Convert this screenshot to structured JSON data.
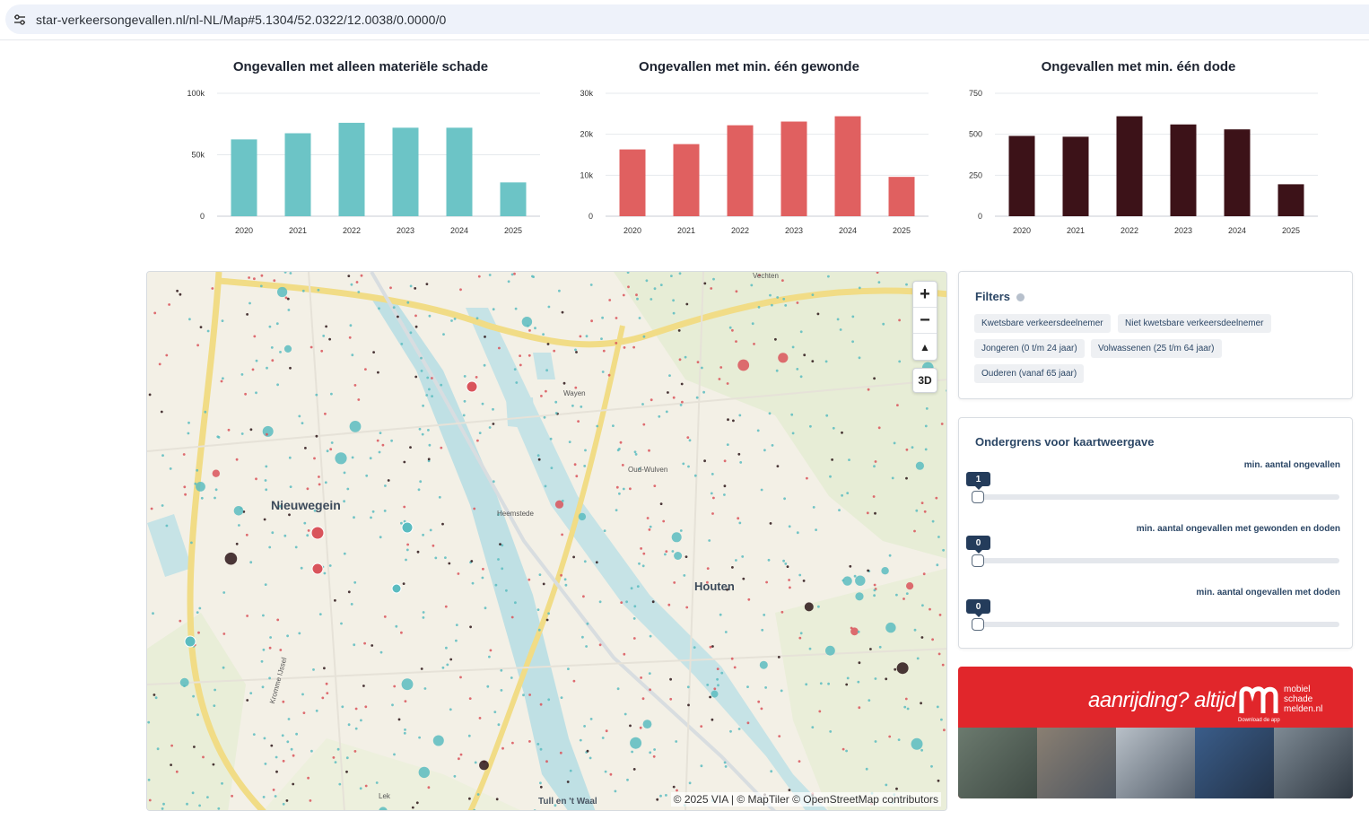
{
  "browser": {
    "url": "star-verkeersongevallen.nl/nl-NL/Map#5.1304/52.0322/12.0038/0.0000/0"
  },
  "charts": {
    "materieel": {
      "title": "Ongevallen met alleen materiële schade"
    },
    "gewonde": {
      "title": "Ongevallen met min. één gewonde"
    },
    "dode": {
      "title": "Ongevallen met min. één dode"
    }
  },
  "chart_data": [
    {
      "type": "bar",
      "title": "Ongevallen met alleen materiële schade",
      "categories": [
        "2020",
        "2021",
        "2022",
        "2023",
        "2024",
        "2025"
      ],
      "values": [
        62500,
        67500,
        76000,
        72000,
        72000,
        27500
      ],
      "ylim": [
        0,
        100000
      ],
      "yticks": [
        "0",
        "50k",
        "100k"
      ],
      "color": "#6cc4c6",
      "grid": true
    },
    {
      "type": "bar",
      "title": "Ongevallen met min. één gewonde",
      "categories": [
        "2020",
        "2021",
        "2022",
        "2023",
        "2024",
        "2025"
      ],
      "values": [
        16300,
        17600,
        22200,
        23100,
        24400,
        9600
      ],
      "ylim": [
        0,
        30000
      ],
      "yticks": [
        "0",
        "10k",
        "20k",
        "30k"
      ],
      "color": "#e06060",
      "grid": true
    },
    {
      "type": "bar",
      "title": "Ongevallen met min. één dode",
      "categories": [
        "2020",
        "2021",
        "2022",
        "2023",
        "2024",
        "2025"
      ],
      "values": [
        490,
        485,
        610,
        560,
        530,
        195
      ],
      "ylim": [
        0,
        750
      ],
      "yticks": [
        "0",
        "250",
        "500",
        "750"
      ],
      "color": "#3c1218",
      "grid": true
    }
  ],
  "map": {
    "places": {
      "nieuwegein": "Nieuwegein",
      "houten": "Houten",
      "vechten": "Vechten",
      "wayen": "Wayen",
      "oud_wulven": "Oud-Wulven",
      "heemstede": "Heemstede",
      "tull": "Tull en 't Waal",
      "lek": "Lek",
      "kromme": "Kromme IJssel"
    },
    "controls": {
      "zoom_in": "+",
      "zoom_out": "−",
      "compass": "▲",
      "btn_3d": "3D"
    },
    "attribution": "© 2025 VIA | © MapTiler © OpenStreetMap contributors"
  },
  "filters": {
    "title": "Filters",
    "chips": [
      "Kwetsbare verkeersdeelnemer",
      "Niet kwetsbare verkeersdeelnemer",
      "Jongeren (0 t/m 24 jaar)",
      "Volwassenen (25 t/m 64 jaar)",
      "Ouderen (vanaf 65 jaar)"
    ]
  },
  "thresholds": {
    "title": "Ondergrens voor kaartweergave",
    "sliders": [
      {
        "label": "min. aantal ongevallen",
        "value": "1"
      },
      {
        "label": "min. aantal ongevallen met gewonden en doden",
        "value": "0"
      },
      {
        "label": "min. aantal ongevallen met doden",
        "value": "0"
      }
    ]
  },
  "banner": {
    "slogan": "aanrijding? altijd",
    "brand_lines": [
      "mobiel",
      "schade",
      "melden.nl"
    ],
    "download": "Download de app"
  }
}
